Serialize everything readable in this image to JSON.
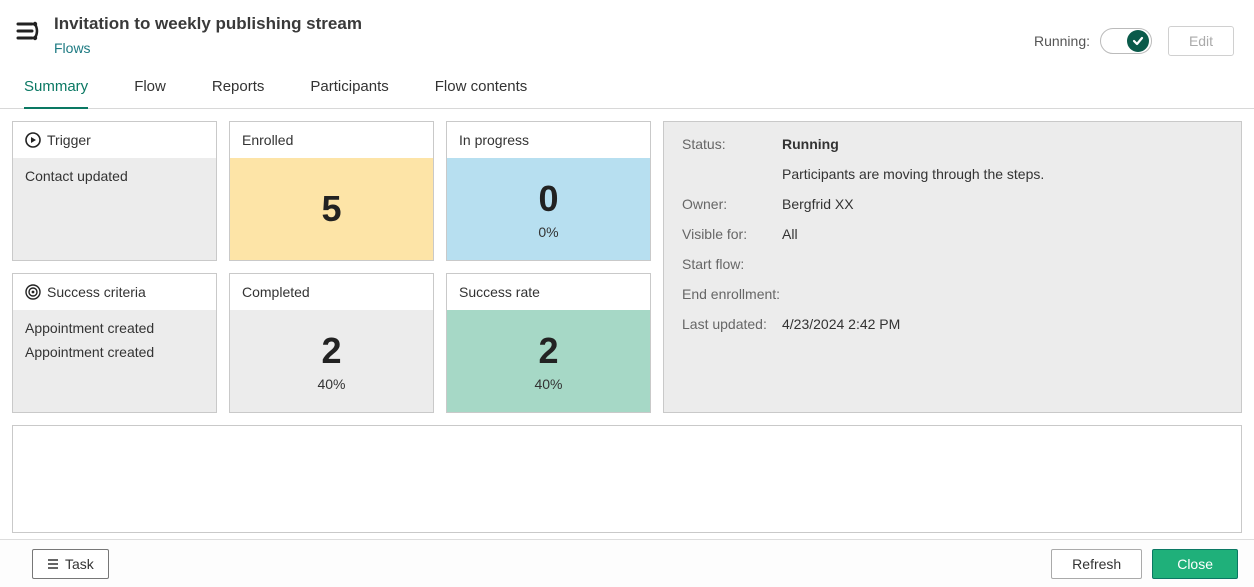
{
  "header": {
    "title": "Invitation to weekly publishing stream",
    "breadcrumb": "Flows",
    "running_label": "Running:",
    "edit_label": "Edit",
    "toggle_on": true
  },
  "tabs": [
    {
      "label": "Summary",
      "active": true
    },
    {
      "label": "Flow",
      "active": false
    },
    {
      "label": "Reports",
      "active": false
    },
    {
      "label": "Participants",
      "active": false
    },
    {
      "label": "Flow contents",
      "active": false
    }
  ],
  "trigger_card": {
    "title": "Trigger",
    "lines": [
      "Contact updated"
    ]
  },
  "success_card": {
    "title": "Success criteria",
    "lines": [
      "Appointment created",
      "Appointment created"
    ]
  },
  "metrics": {
    "enrolled": {
      "label": "Enrolled",
      "value": "5",
      "sub": ""
    },
    "inprogress": {
      "label": "In progress",
      "value": "0",
      "sub": "0%"
    },
    "completed": {
      "label": "Completed",
      "value": "2",
      "sub": "40%"
    },
    "successrate": {
      "label": "Success rate",
      "value": "2",
      "sub": "40%"
    }
  },
  "status": {
    "status_label": "Status:",
    "status_value": "Running",
    "status_desc": "Participants are moving through the steps.",
    "owner_label": "Owner:",
    "owner_value": "Bergfrid XX",
    "visible_label": "Visible for:",
    "visible_value": "All",
    "start_label": "Start flow:",
    "start_value": "",
    "end_label": "End enrollment:",
    "end_value": "",
    "updated_label": "Last updated:",
    "updated_value": "4/23/2024 2:42 PM"
  },
  "footer": {
    "task_label": "Task",
    "refresh_label": "Refresh",
    "close_label": "Close"
  },
  "colors": {
    "accent": "#0a7863",
    "green_btn": "#1fb07a",
    "yellow": "#fde4a7",
    "blue": "#b7dff0",
    "grey": "#ececec",
    "teal": "#a6d8c6"
  }
}
